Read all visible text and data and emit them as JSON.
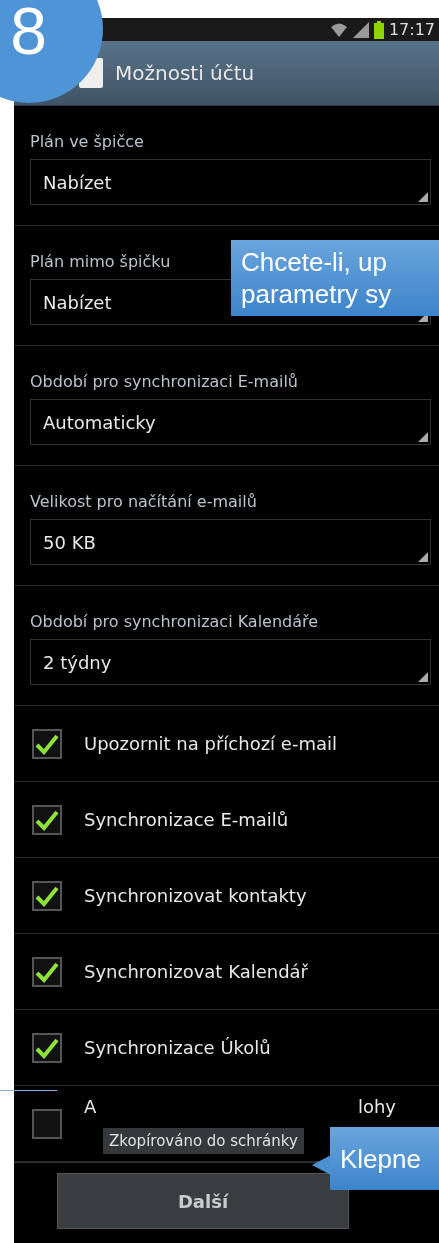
{
  "step_badge": "8",
  "status_bar": {
    "time": "17:17"
  },
  "action_bar": {
    "title": "Možnosti účtu"
  },
  "settings": [
    {
      "label": "Plán ve špičce",
      "value": "Nabízet"
    },
    {
      "label": "Plán mimo špičku",
      "value": "Nabízet"
    },
    {
      "label": "Období pro synchronizaci E-mailů",
      "value": "Automaticky"
    },
    {
      "label": "Velikost pro načítání e-mailů",
      "value": "50 KB"
    },
    {
      "label": "Období pro synchronizaci Kalendáře",
      "value": "2 týdny"
    }
  ],
  "options": [
    {
      "label": "Upozornit na příchozí e-mail",
      "checked": true
    },
    {
      "label": "Synchronizace E-mailů",
      "checked": true
    },
    {
      "label": "Synchronizovat kontakty",
      "checked": true
    },
    {
      "label": "Synchronizovat Kalendář",
      "checked": true
    },
    {
      "label": "Synchronizace Úkolů",
      "checked": true
    },
    {
      "label_fragments": [
        "A",
        "lohy"
      ],
      "checked": false
    }
  ],
  "toast": "Zkopírováno do schránky",
  "next_button": "Další",
  "callouts": [
    {
      "text": "Chcete-li, up\nparametry sy"
    },
    {
      "text": "Klepne"
    }
  ]
}
